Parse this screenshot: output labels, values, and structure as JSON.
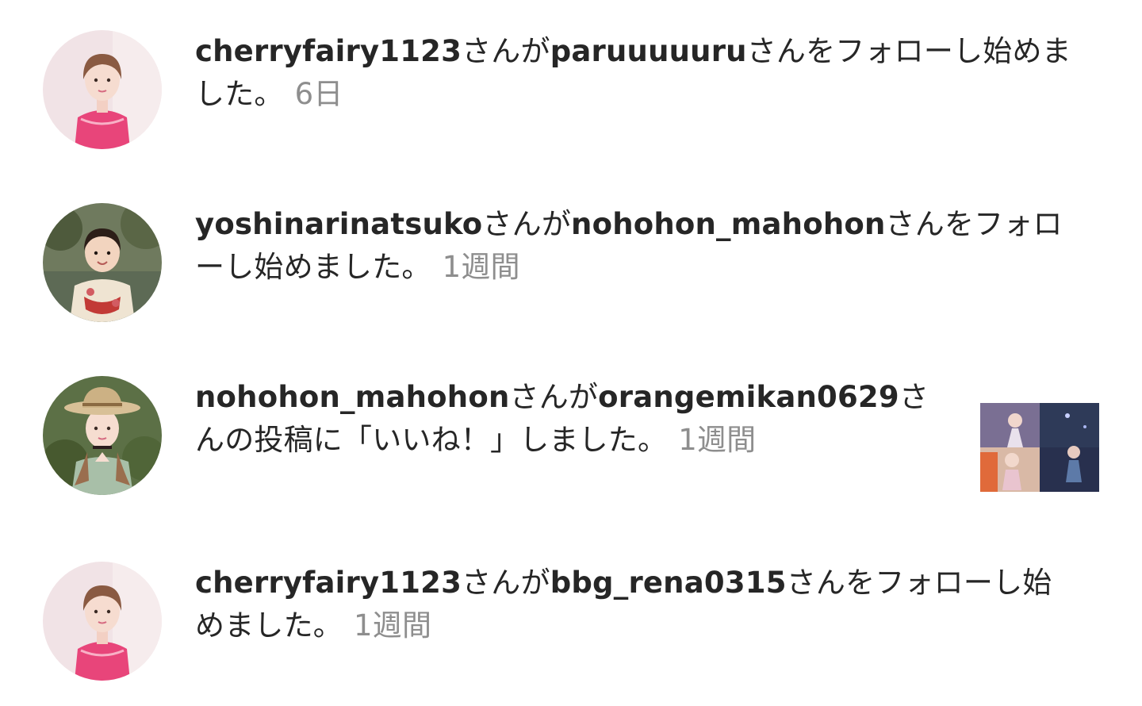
{
  "activity": [
    {
      "user": "cherryfairy1123",
      "connector": "さんが",
      "target": "paruuuuuru",
      "action": "さんをフォローし始めました。",
      "time": "6日",
      "avatar": "avatar-pink-dress-short-hair"
    },
    {
      "user": "yoshinarinatsuko",
      "connector": "さんが",
      "target": "nohohon_mahohon",
      "action": "さんをフォローし始めました。",
      "time": "1週間",
      "avatar": "avatar-child-yukata"
    },
    {
      "user": "nohohon_mahohon",
      "connector": "さんが",
      "target": "orangemikan0629",
      "action": "さんの投稿に「いいね！」しました。",
      "time": "1週間",
      "avatar": "avatar-straw-hat-green-dress",
      "thumbnail": "post-thumbnail-concert"
    },
    {
      "user": "cherryfairy1123",
      "connector": "さんが",
      "target": "bbg_rena0315",
      "action": "さんをフォローし始めました。",
      "time": "1週間",
      "avatar": "avatar-pink-dress-short-hair"
    }
  ],
  "colors": {
    "text": "#262626",
    "muted": "#8e8e8e",
    "background": "#ffffff"
  }
}
